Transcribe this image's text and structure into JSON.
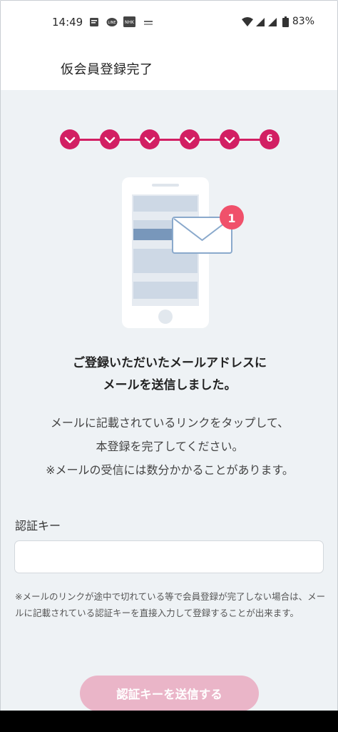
{
  "status_bar": {
    "time": "14:49",
    "battery": "83%",
    "icons": [
      "message-icon",
      "line-app-icon",
      "nhk-app-icon",
      "app-icon",
      "wifi-icon",
      "signal-icon",
      "signal-icon",
      "battery-icon"
    ]
  },
  "header": {
    "title": "仮会員登録完了"
  },
  "stepper": {
    "completed_steps": 5,
    "current_step_label": "6",
    "accent_color": "#d21f63"
  },
  "illustration": {
    "badge_count": "1"
  },
  "message": {
    "heading_line1": "ご登録いただいたメールアドレスに",
    "heading_line2": "メールを送信しました。",
    "body_line1": "メールに記載されているリンクをタップして、",
    "body_line2": "本登録を完了してください。",
    "body_line3": "※メールの受信には数分かかることがあります。"
  },
  "auth_key": {
    "label": "認証キー",
    "value": "",
    "placeholder": "",
    "help_text": "※メールのリンクが途中で切れている等で会員登録が完了しない場合は、メールに記載されている認証キーを直接入力して登録することが出来ます。"
  },
  "submit": {
    "label": "認証キーを送信する",
    "color": "#eab5c8"
  }
}
